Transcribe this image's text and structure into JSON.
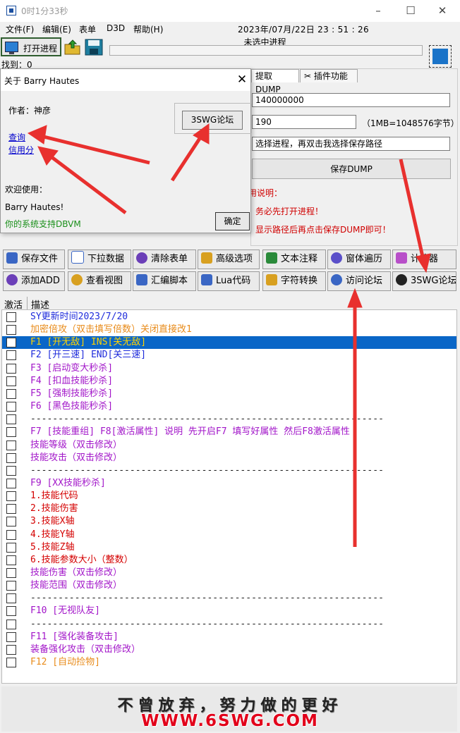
{
  "window": {
    "title": "0时1分33秒"
  },
  "menu": {
    "file": "文件(F)",
    "edit": "编辑(E)",
    "form": "表单",
    "d3d": "D3D",
    "help": "帮助(H)",
    "clock": "2023年/07月/22日 23 : 51 : 26"
  },
  "toolbar": {
    "open_process": "打开进程",
    "process_status": "未选中进程",
    "found_label": "找到：0"
  },
  "tabs": {
    "dump": "提取DUMP",
    "plugins": "插件功能"
  },
  "dump": {
    "address": "140000000",
    "size": "190",
    "size_note": "（1MB=1048576字节）",
    "path_hint": "选择进程，再双击我选择保存路径",
    "save_button": "保存DUMP"
  },
  "usage": {
    "title": "使用说明：",
    "line1": "务必先打开进程！",
    "line2": "显示路径后再点击保存DUMP即可！"
  },
  "about": {
    "title": "关于 Barry Hautes",
    "author": "作者：神彦",
    "forum_button": "3SWG论坛",
    "link_query": "查询",
    "link_credit": "信用分",
    "welcome": "欢迎使用：",
    "name": "Barry Hautes!",
    "dbvm": "你的系统支持DBVM",
    "ok": "确定"
  },
  "buttons": [
    [
      "保存文件",
      "下拉数据",
      "清除表单",
      "高级选项",
      "文本注释",
      "窗体遍历",
      "计算器"
    ],
    [
      "添加ADD",
      "查看视图",
      "汇编脚本",
      "Lua代码",
      "字符转换",
      "访问论坛",
      "3SWG论坛"
    ]
  ],
  "list": {
    "col_active": "激活",
    "col_desc": "描述",
    "rows": [
      {
        "text": "SY更新时间2023/7/20",
        "color": "blue"
      },
      {
        "text": "加密倍攻（双击填写倍数）关闭直接改1",
        "color": "orange"
      },
      {
        "text": "F1 [开无敌]     INS[关无敌]",
        "color": "yellow",
        "selected": true
      },
      {
        "text": "F2 [开三速]     END[关三速]",
        "color": "blue"
      },
      {
        "text": "F3 [启动变大秒杀]",
        "color": "purple"
      },
      {
        "text": "F4 [扣血技能秒杀]",
        "color": "purple"
      },
      {
        "text": "F5 [强制技能秒杀]",
        "color": "purple"
      },
      {
        "text": "F6 [黑色技能秒杀]",
        "color": "purple"
      },
      {
        "text": "----------------------------------------------------------------",
        "color": "dash"
      },
      {
        "text": "F7 [技能重组]  F8[激活属性] 说明 先开启F7 填写好属性  然后F8激活属性",
        "color": "purple"
      },
      {
        "text": "技能等级（双击修改）",
        "color": "purple"
      },
      {
        "text": "技能攻击（双击修改）",
        "color": "purple"
      },
      {
        "text": "----------------------------------------------------------------",
        "color": "dash"
      },
      {
        "text": "F9 [XX技能秒杀]",
        "color": "purple"
      },
      {
        "text": "1.技能代码",
        "color": "red"
      },
      {
        "text": "2.技能伤害",
        "color": "red"
      },
      {
        "text": "3.技能X轴",
        "color": "red"
      },
      {
        "text": "4.技能Y轴",
        "color": "red"
      },
      {
        "text": "5.技能Z轴",
        "color": "red"
      },
      {
        "text": "6.技能参数大小（整数）",
        "color": "red"
      },
      {
        "text": "技能伤害（双击修改）",
        "color": "purple"
      },
      {
        "text": "技能范围（双击修改）",
        "color": "purple"
      },
      {
        "text": "----------------------------------------------------------------",
        "color": "dash"
      },
      {
        "text": "F10 [无视队友]",
        "color": "purple"
      },
      {
        "text": "----------------------------------------------------------------",
        "color": "dash"
      },
      {
        "text": "F11 [强化装备攻击]",
        "color": "purple"
      },
      {
        "text": "装备强化攻击（双击修改）",
        "color": "purple"
      },
      {
        "text": "F12 [自动捡物]",
        "color": "orange"
      }
    ]
  },
  "footer": {
    "slogan": "不曾放弃，努力做的更好",
    "site": "WWW.6SWG.COM"
  },
  "colors": {
    "selected_row": "#0a66c7",
    "arrow": "#e8302e",
    "accent_blue": "#1a73c8"
  }
}
